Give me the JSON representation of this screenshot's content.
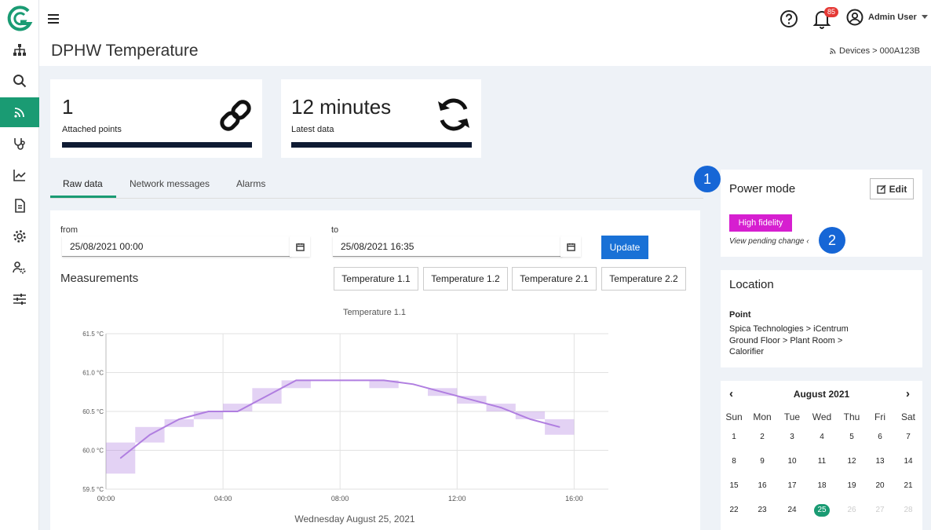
{
  "app": {
    "title": "DPHW Temperature"
  },
  "header": {
    "notifications_count": "85",
    "user_name": "Admin User"
  },
  "breadcrumb": {
    "devices": "Devices",
    "separator": ">",
    "device_id": "000A123B"
  },
  "sidebar": {
    "items": [
      "hierarchy-icon",
      "search-icon",
      "devices-icon",
      "stethoscope-icon",
      "chart-icon",
      "report-icon",
      "settings-icon",
      "user-settings-icon",
      "sliders-icon"
    ],
    "active_index": 2
  },
  "stats": [
    {
      "value": "1",
      "label": "Attached points",
      "icon": "link-icon"
    },
    {
      "value": "12 minutes",
      "label": "Latest data",
      "icon": "refresh-icon"
    }
  ],
  "tabs": [
    {
      "label": "Raw data"
    },
    {
      "label": "Network messages"
    },
    {
      "label": "Alarms"
    }
  ],
  "filters": {
    "from_label": "from",
    "from_value": "25/08/2021 00:00",
    "to_label": "to",
    "to_value": "25/08/2021 16:35",
    "update_label": "Update"
  },
  "measurements": {
    "title": "Measurements",
    "series_buttons": [
      "Temperature 1.1",
      "Temperature 1.2",
      "Temperature 2.1",
      "Temperature 2.2"
    ]
  },
  "chart_data": {
    "type": "line",
    "title": "Temperature 1.1",
    "xlabel": "Wednesday August 25, 2021",
    "ylabel": "",
    "x_ticks": [
      "00:00",
      "04:00",
      "08:00",
      "12:00",
      "16:00"
    ],
    "y_ticks": [
      "59.5 °C",
      "60.0 °C",
      "60.5 °C",
      "61.0 °C",
      "61.5 °C"
    ],
    "ylim": [
      59.5,
      61.5
    ],
    "xlim_hours": [
      0,
      16.5
    ],
    "grid": true,
    "color": "#b07ee0",
    "series": [
      {
        "x_hours": [
          0.5,
          1.5,
          2.5,
          3.5,
          4.5,
          5.5,
          6.5,
          7.5,
          8.5,
          9.5,
          10.5,
          11.5,
          12.5,
          13.5,
          14.5,
          15.5
        ],
        "values": [
          59.9,
          60.2,
          60.4,
          60.5,
          60.5,
          60.7,
          60.9,
          60.9,
          60.9,
          60.9,
          60.85,
          60.75,
          60.65,
          60.55,
          60.4,
          60.3
        ]
      }
    ],
    "bands": [
      {
        "x0": 0,
        "x1": 1,
        "lo": 59.7,
        "hi": 60.1
      },
      {
        "x0": 1,
        "x1": 2,
        "lo": 60.1,
        "hi": 60.3
      },
      {
        "x0": 2,
        "x1": 3,
        "lo": 60.3,
        "hi": 60.4
      },
      {
        "x0": 3,
        "x1": 4,
        "lo": 60.4,
        "hi": 60.5
      },
      {
        "x0": 4,
        "x1": 5,
        "lo": 60.5,
        "hi": 60.6
      },
      {
        "x0": 5,
        "x1": 6,
        "lo": 60.6,
        "hi": 60.8
      },
      {
        "x0": 6,
        "x1": 7,
        "lo": 60.8,
        "hi": 60.9
      },
      {
        "x0": 9,
        "x1": 10,
        "lo": 60.8,
        "hi": 60.9
      },
      {
        "x0": 11,
        "x1": 12,
        "lo": 60.7,
        "hi": 60.8
      },
      {
        "x0": 12,
        "x1": 13,
        "lo": 60.6,
        "hi": 60.7
      },
      {
        "x0": 13,
        "x1": 14,
        "lo": 60.5,
        "hi": 60.6
      },
      {
        "x0": 14,
        "x1": 15,
        "lo": 60.4,
        "hi": 60.5
      },
      {
        "x0": 15,
        "x1": 16,
        "lo": 60.2,
        "hi": 60.4
      }
    ]
  },
  "power_mode": {
    "title": "Power mode",
    "edit_label": "Edit",
    "mode": "High fidelity",
    "pending": "View pending change",
    "marker_1": "1",
    "marker_2": "2"
  },
  "location": {
    "title": "Location",
    "subtitle": "Point",
    "lines": [
      "Spica Technologies > iCentrum",
      "Ground Floor > Plant Room >",
      "Calorifier"
    ]
  },
  "calendar": {
    "month": "August 2021",
    "weekdays": [
      "Sun",
      "Mon",
      "Tue",
      "Wed",
      "Thu",
      "Fri",
      "Sat"
    ],
    "weeks": [
      [
        "1",
        "2",
        "3",
        "4",
        "5",
        "6",
        "7"
      ],
      [
        "8",
        "9",
        "10",
        "11",
        "12",
        "13",
        "14"
      ],
      [
        "15",
        "16",
        "17",
        "18",
        "19",
        "20",
        "21"
      ],
      [
        "22",
        "23",
        "24",
        "25",
        "26",
        "27",
        "28"
      ]
    ],
    "selected": "25"
  }
}
